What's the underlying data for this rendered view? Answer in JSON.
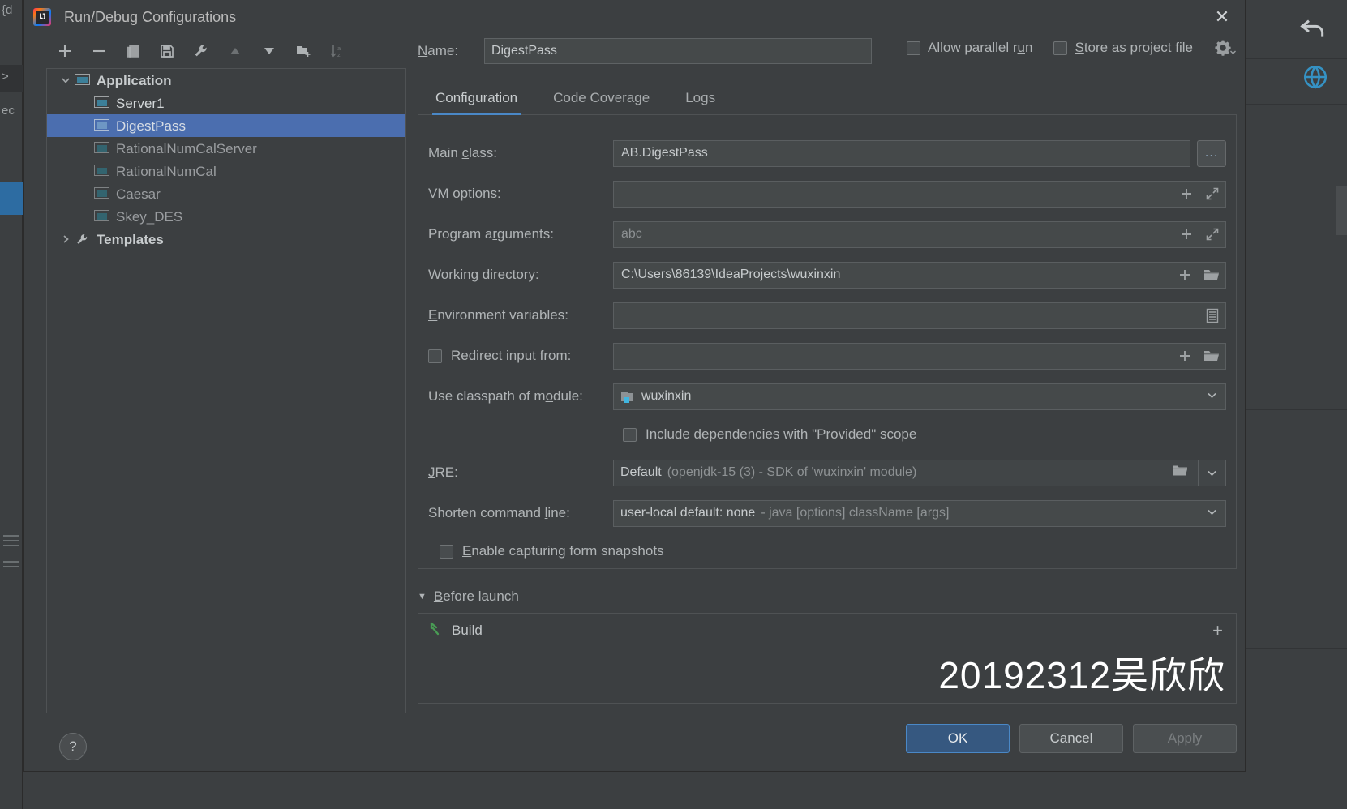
{
  "window": {
    "title": "Run/Debug Configurations",
    "app_icon": "intellij-idea-icon",
    "close_label": "✕"
  },
  "toolbar": {
    "buttons": [
      {
        "name": "add-configuration-button",
        "glyph": "+"
      },
      {
        "name": "remove-configuration-button",
        "glyph": "−"
      },
      {
        "name": "copy-configuration-button",
        "glyph": "copy-icon"
      },
      {
        "name": "save-configuration-button",
        "glyph": "save-icon"
      },
      {
        "name": "edit-templates-button",
        "glyph": "wrench-icon"
      },
      {
        "name": "move-up-button",
        "glyph": "▲"
      },
      {
        "name": "move-down-button",
        "glyph": "▼"
      },
      {
        "name": "new-folder-button",
        "glyph": "folder-add-icon"
      },
      {
        "name": "sort-configurations-button",
        "glyph": "sort-az-icon"
      }
    ]
  },
  "tree": {
    "items": [
      {
        "label": "Application",
        "level": 1,
        "group": true,
        "expanded": true,
        "icon": "application-icon",
        "selected": false,
        "bright": true
      },
      {
        "label": "Server1",
        "level": 2,
        "group": false,
        "icon": "application-icon",
        "selected": false,
        "bright": true
      },
      {
        "label": "DigestPass",
        "level": 2,
        "group": false,
        "icon": "application-icon",
        "selected": true,
        "bright": false
      },
      {
        "label": "RationalNumCalServer",
        "level": 2,
        "group": false,
        "icon": "application-icon",
        "selected": false,
        "bright": false
      },
      {
        "label": "RationalNumCal",
        "level": 2,
        "group": false,
        "icon": "application-icon",
        "selected": false,
        "bright": false
      },
      {
        "label": "Caesar",
        "level": 2,
        "group": false,
        "icon": "application-icon",
        "selected": false,
        "bright": false
      },
      {
        "label": "Skey_DES",
        "level": 2,
        "group": false,
        "icon": "application-icon",
        "selected": false,
        "bright": false
      },
      {
        "label": "Templates",
        "level": 1,
        "group": true,
        "expanded": false,
        "icon": "wrench-icon",
        "selected": false,
        "bright": true
      }
    ]
  },
  "help_button": {
    "label": "?",
    "name": "help-button"
  },
  "name_field": {
    "label": "Name:",
    "value": "DigestPass"
  },
  "top_options": {
    "allow_parallel_run": {
      "label": "Allow parallel run",
      "checked": false
    },
    "store_as_project_file": {
      "label": "Store as project file",
      "checked": false
    },
    "gear_icon": "gear-dropdown-icon"
  },
  "tabs": [
    {
      "label": "Configuration",
      "active": true
    },
    {
      "label": "Code Coverage",
      "active": false
    },
    {
      "label": "Logs",
      "active": false
    }
  ],
  "form": {
    "main_class": {
      "label": "Main class:",
      "value": "AB.DigestPass",
      "browse_label": "..."
    },
    "vm_options": {
      "label": "VM options:",
      "value": "",
      "placeholder": ""
    },
    "program_arguments": {
      "label": "Program arguments:",
      "value": "abc"
    },
    "working_directory": {
      "label": "Working directory:",
      "value": "C:\\Users\\86139\\IdeaProjects\\wuxinxin"
    },
    "environment_variables": {
      "label": "Environment variables:",
      "value": ""
    },
    "redirect_input": {
      "label": "Redirect input from:",
      "checked": false,
      "value": ""
    },
    "use_classpath_of_module": {
      "label": "Use classpath of module:",
      "value": "wuxinxin"
    },
    "include_provided_scope": {
      "label": "Include dependencies with \"Provided\" scope",
      "checked": false
    },
    "jre": {
      "label": "JRE:",
      "value": "Default",
      "detail": "(openjdk-15 (3) - SDK of 'wuxinxin' module)"
    },
    "shorten_command_line": {
      "label": "Shorten command line:",
      "value": "user-local default: none",
      "detail": "- java [options] className [args]"
    },
    "enable_form_snapshots": {
      "label": "Enable capturing form snapshots",
      "checked": false
    }
  },
  "before_launch": {
    "title": "Before launch",
    "items": [
      {
        "label": "Build",
        "icon": "build-hammer-icon"
      }
    ],
    "add_label": "+",
    "remove_label": "−"
  },
  "footer": {
    "ok": "OK",
    "cancel": "Cancel",
    "apply": "Apply"
  },
  "watermark": "20192312吴欣欣",
  "colors": {
    "accent": "#4a88c7",
    "selection": "#4b6eaf",
    "primary_button": "#365880",
    "panel_bg": "#3c3f41",
    "input_bg": "#45494a",
    "build_icon": "#499c54"
  }
}
